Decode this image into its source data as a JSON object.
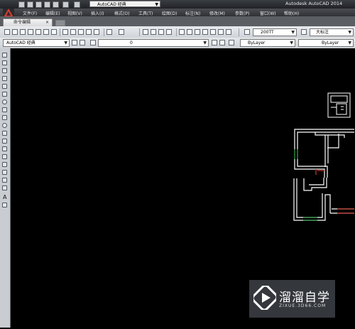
{
  "app_title": "Autodesk AutoCAD 2014",
  "workspace": "AutoCAD 经典",
  "menu": [
    "文件(F)",
    "编辑(E)",
    "视图(V)",
    "插入(I)",
    "格式(O)",
    "工具(T)",
    "绘图(D)",
    "标注(N)",
    "修改(M)",
    "参数(P)",
    "窗口(W)",
    "帮助(H)"
  ],
  "tab": {
    "label": "命令编辑"
  },
  "toolbar1": {
    "text_style": "200TT",
    "dim_style": "大标注"
  },
  "toolbar2": {
    "workspace": "AutoCAD 经典",
    "layer": "0",
    "color": "ByLayer",
    "linetype": "ByLayer"
  },
  "watermark": {
    "title": "溜溜自学",
    "url": "ZIXUE.3D66.COM"
  },
  "colors": {
    "canvas": "#000000",
    "wall": "#ffffff",
    "door_red": "#c0392b",
    "window_green": "#2e9a46"
  }
}
